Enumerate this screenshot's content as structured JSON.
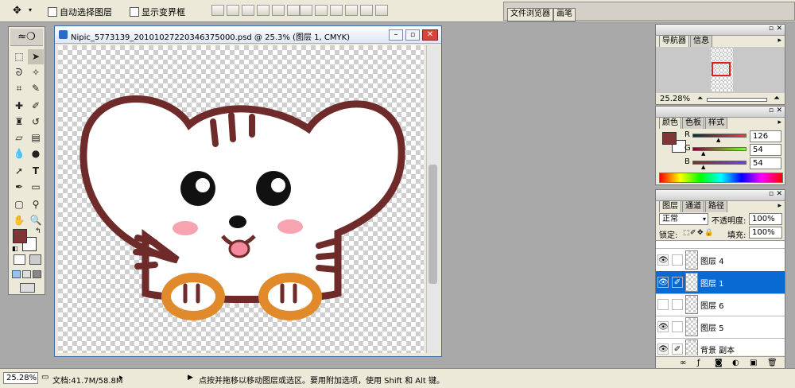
{
  "options_bar": {
    "tool_icon": "move-tool-icon",
    "auto_select_label": "自动选择图层",
    "show_bounds_label": "显示变界框"
  },
  "well": {
    "tabs": [
      "文件浏览器",
      "画笔"
    ]
  },
  "document": {
    "title": "Nipic_5773139_20101027220346375000.psd @ 25.3% (图层 1, CMYK)"
  },
  "colors": {
    "foreground": "#7e3636",
    "background": "#ffffff",
    "selected_row": "#0a6ad4",
    "artwork_outline": "#6f2a2a",
    "artwork_cheek": "#f7a3b0",
    "artwork_paw": "#e08a2c"
  },
  "navigator": {
    "tabs": [
      "导航器",
      "信息"
    ],
    "zoom": "25.28%"
  },
  "color_panel": {
    "tabs": [
      "颜色",
      "色板",
      "样式"
    ],
    "channels": [
      {
        "label": "R",
        "value": "126",
        "level": 0.49
      },
      {
        "label": "G",
        "value": "54",
        "level": 0.21
      },
      {
        "label": "B",
        "value": "54",
        "level": 0.21
      }
    ]
  },
  "layers_panel": {
    "tabs": [
      "图层",
      "通道",
      "路径"
    ],
    "blend_mode": "正常",
    "opacity_label": "不透明度:",
    "opacity_value": "100%",
    "lock_label": "锁定:",
    "fill_label": "填充:",
    "fill_value": "100%",
    "layers": [
      {
        "name": "图层 4",
        "visible": true,
        "linked": false,
        "selected": false
      },
      {
        "name": "图层 1",
        "visible": true,
        "linked": true,
        "selected": true
      },
      {
        "name": "图层 6",
        "visible": false,
        "linked": false,
        "selected": false
      },
      {
        "name": "图层 5",
        "visible": true,
        "linked": false,
        "selected": false
      },
      {
        "name": "背景 副本",
        "visible": true,
        "linked": true,
        "selected": false
      }
    ]
  },
  "status_bar": {
    "zoom": "25.28%",
    "doc_size": "文档:41.7M/58.8M",
    "hint": "点按并拖移以移动图层或选区。要用附加选项，使用 Shift 和 Alt 键。"
  }
}
